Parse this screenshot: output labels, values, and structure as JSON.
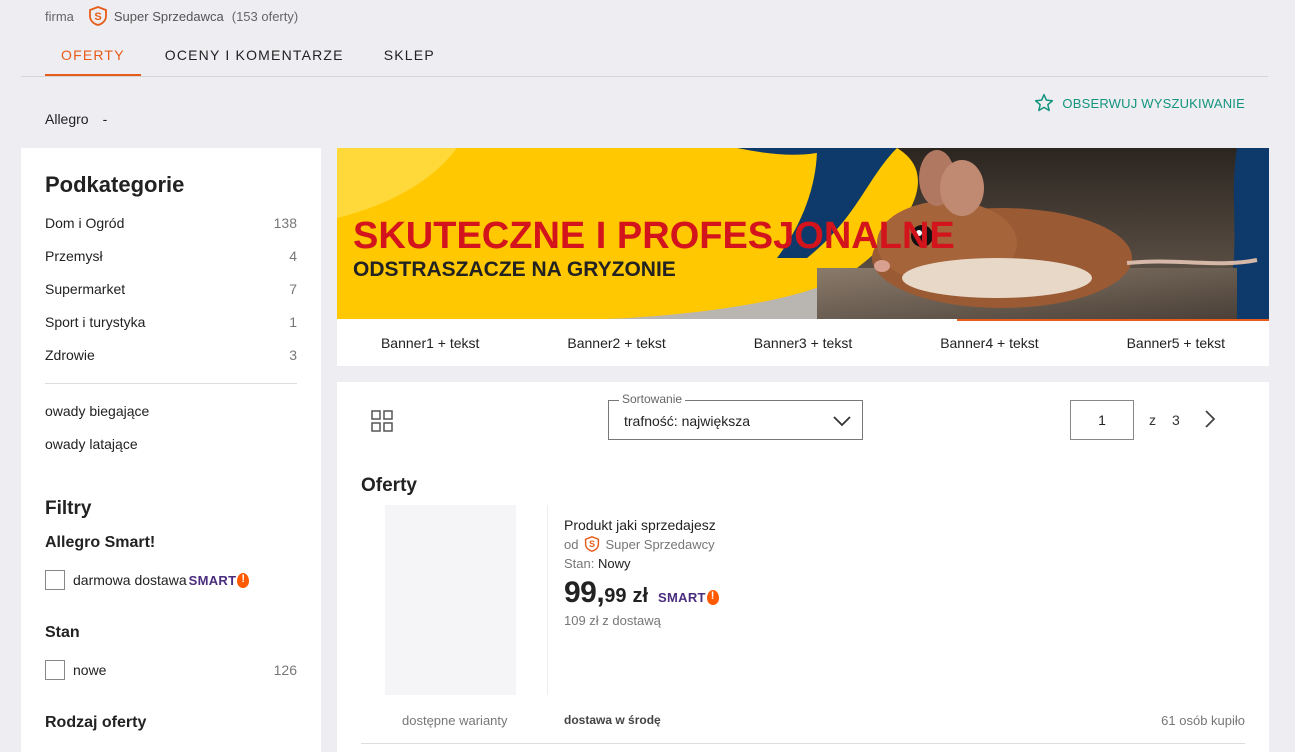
{
  "header": {
    "firm_label": "firma",
    "seller_label": "Super Sprzedawca",
    "offers_count": "(153 oferty)"
  },
  "tabs": [
    {
      "label": "OFERTY",
      "active": true
    },
    {
      "label": "OCENY I KOMENTARZE",
      "active": false
    },
    {
      "label": "SKLEP",
      "active": false
    }
  ],
  "breadcrumb": {
    "root": "Allegro",
    "sep": "-"
  },
  "observe_label": "OBSERWUJ WYSZUKIWANIE",
  "sidebar": {
    "title": "Podkategorie",
    "categories": [
      {
        "label": "Dom i Ogród",
        "count": "138"
      },
      {
        "label": "Przemysł",
        "count": "4"
      },
      {
        "label": "Supermarket",
        "count": "7"
      },
      {
        "label": "Sport i turystyka",
        "count": "1"
      },
      {
        "label": "Zdrowie",
        "count": "3"
      }
    ],
    "tags": [
      "owady biegające",
      "owady latające"
    ],
    "filters_title": "Filtry",
    "smart_group": "Allegro Smart!",
    "free_delivery_label": "darmowa dostawa",
    "smart_word": "SMART",
    "condition_group": "Stan",
    "new_label": "nowe",
    "new_count": "126",
    "offer_type_group": "Rodzaj oferty"
  },
  "banner": {
    "headline": "SKUTECZNE I PROFESJONALNE",
    "subline": "ODSTRASZACZE NA GRYZONIE",
    "links": [
      "Banner1 + tekst",
      "Banner2 + tekst",
      "Banner3 + tekst",
      "Banner4 + tekst",
      "Banner5 + tekst"
    ]
  },
  "listing": {
    "sort_legend": "Sortowanie",
    "sort_value": "trafność: największa",
    "page_current": "1",
    "page_of": "z",
    "page_total": "3",
    "title": "Oferty"
  },
  "product": {
    "name": "Produkt jaki sprzedajesz",
    "from_label": "od",
    "seller": "Super Sprzedawcy",
    "condition_label": "Stan:",
    "condition_value": "Nowy",
    "price_int": "99,",
    "price_dec": "99",
    "currency": "zł",
    "smart_word": "SMART",
    "price_with_delivery": "109 zł z dostawą",
    "variants": "dostępne warianty",
    "delivery_when": "dostawa w środę",
    "bought": "61 osób kupiło"
  },
  "colors": {
    "accent": "#e65c1a",
    "observe": "#13947f",
    "smart": "#4b2d7f",
    "banner_red": "#d4141c",
    "banner_yellow": "#ffc800",
    "banner_navy": "#0d3a6b"
  }
}
